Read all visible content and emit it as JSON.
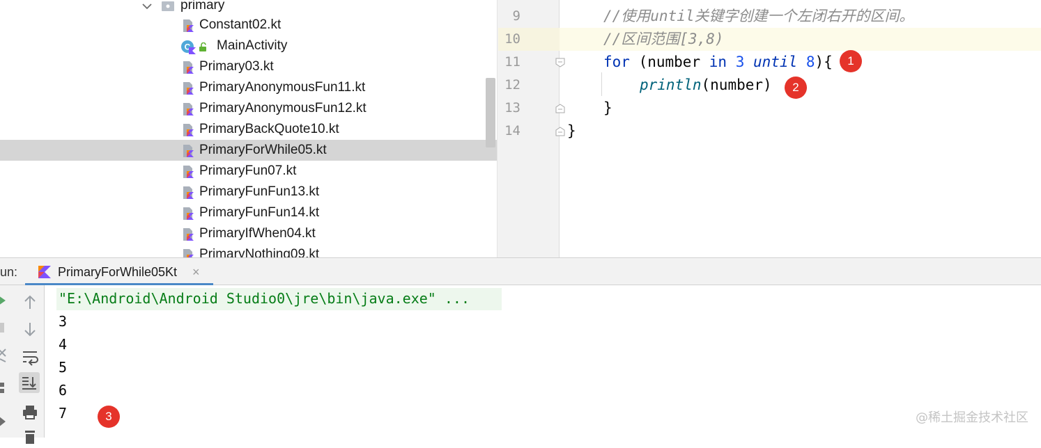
{
  "project_tree": {
    "folder": {
      "label": "primary"
    },
    "items": [
      {
        "label": "Constant02.kt",
        "type": "kotlin-file"
      },
      {
        "label": "MainActivity",
        "type": "kotlin-class"
      },
      {
        "label": "Primary03.kt",
        "type": "kotlin-file"
      },
      {
        "label": "PrimaryAnonymousFun11.kt",
        "type": "kotlin-file"
      },
      {
        "label": "PrimaryAnonymousFun12.kt",
        "type": "kotlin-file"
      },
      {
        "label": "PrimaryBackQuote10.kt",
        "type": "kotlin-file"
      },
      {
        "label": "PrimaryForWhile05.kt",
        "type": "kotlin-file",
        "selected": true
      },
      {
        "label": "PrimaryFun07.kt",
        "type": "kotlin-file"
      },
      {
        "label": "PrimaryFunFun13.kt",
        "type": "kotlin-file"
      },
      {
        "label": "PrimaryFunFun14.kt",
        "type": "kotlin-file"
      },
      {
        "label": "PrimaryIfWhen04.kt",
        "type": "kotlin-file"
      },
      {
        "label": "PrimaryNothing09.kt",
        "type": "kotlin-file"
      }
    ]
  },
  "editor": {
    "lines": [
      {
        "num": "9",
        "text": "//使用until关键字创建一个左闭右开的区间。"
      },
      {
        "num": "10",
        "text": "//区间范围[3,8)"
      },
      {
        "num": "11",
        "kw_for": "for",
        "paren_open": " (number ",
        "kw_in": "in",
        "sp": " ",
        "n1": "3",
        "sp2": " ",
        "kw_until": "until",
        "sp3": " ",
        "n2": "8",
        "tail": "){"
      },
      {
        "num": "12",
        "fn": "println",
        "args": "(number)"
      },
      {
        "num": "13",
        "text": "}"
      },
      {
        "num": "14",
        "text": "}"
      }
    ],
    "badges": [
      "1",
      "2"
    ]
  },
  "run_panel": {
    "label": "un:",
    "tab_title": "PrimaryForWhile05Kt",
    "close_glyph": "×",
    "command": "\"E:\\Android\\Android Studio0\\jre\\bin\\java.exe\" ...",
    "output": [
      "3",
      "4",
      "5",
      "6",
      "7"
    ],
    "badge": "3"
  },
  "watermark": "@稀土掘金技术社区",
  "colors": {
    "selection": "#d5d5d5",
    "keyword": "#0033b3",
    "number": "#1750eb",
    "comment": "#8c8c8c",
    "function": "#00627a",
    "console_cmd": "#067d17",
    "badge": "#e5332a",
    "tab_underline": "#4a88c7"
  },
  "icons": {
    "file": "kotlin-file-icon",
    "class": "kotlin-class-icon",
    "folder": "package-folder-icon"
  }
}
